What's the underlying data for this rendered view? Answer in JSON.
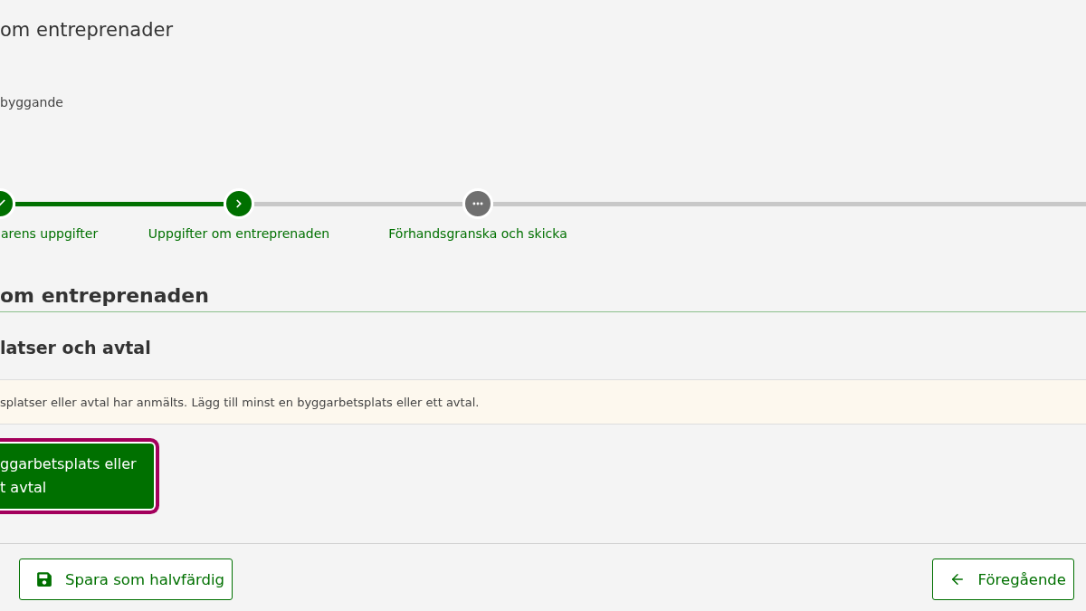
{
  "page_title": "om entreprenader",
  "subtitle": "byggande",
  "steps": [
    {
      "label": "arens uppgifter",
      "kind": "done"
    },
    {
      "label": "Uppgifter om entreprenaden",
      "kind": "current"
    },
    {
      "label": "Förhandsgranska och skicka",
      "kind": "pending"
    }
  ],
  "section_heading": "om entreprenaden",
  "subsection_heading": "latser och avtal",
  "notice": "splatser eller avtal har anmälts. Lägg till minst en byggarbetsplats eller ett avtal.",
  "add_button": {
    "label": "ggarbetsplats eller\nt avtal",
    "focused": true
  },
  "footer": {
    "save_button": "Spara som halvfärdig",
    "back_button": "Föregående"
  }
}
